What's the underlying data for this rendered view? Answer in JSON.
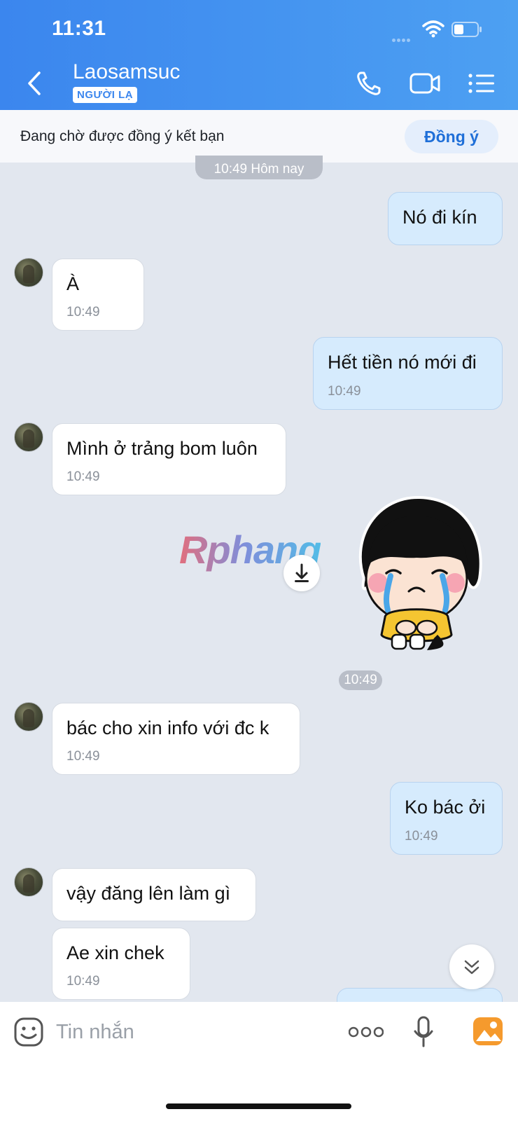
{
  "status_bar": {
    "time": "11:31"
  },
  "header": {
    "contact_name": "Laosamsuc",
    "stranger_badge": "NGƯỜI LẠ",
    "icons": [
      "back-icon",
      "phone-icon",
      "video-call-icon",
      "menu-list-icon"
    ]
  },
  "friend_request": {
    "text": "Đang chờ được đồng ý kết bạn",
    "accept_label": "Đồng ý"
  },
  "chat": {
    "date_separator": "10:49 Hôm nay",
    "messages": [
      {
        "from": "me",
        "text": "Nó đi kín",
        "time": ""
      },
      {
        "from": "them",
        "text": "À",
        "time": "10:49"
      },
      {
        "from": "me",
        "text": "Hết tiền nó mới đi",
        "time": "10:49"
      },
      {
        "from": "them",
        "text": "Mình ở trảng bom luôn",
        "time": "10:49"
      },
      {
        "from": "me",
        "type": "sticker",
        "sticker": "crying-girl-sticker",
        "time": "10:49"
      },
      {
        "from": "them",
        "text": "bác cho xin info với đc k",
        "time": "10:49"
      },
      {
        "from": "me",
        "text": "Ko bác ởi",
        "time": "10:49"
      },
      {
        "from": "them",
        "text": "vậy đăng lên làm gì",
        "time": ""
      },
      {
        "from": "them",
        "text": "Ae xin chek",
        "time": "10:49"
      }
    ],
    "watermark": "Rphang"
  },
  "composer": {
    "placeholder": "Tin nhắn",
    "icons": [
      "emoji-icon",
      "more-icon",
      "microphone-icon",
      "image-icon"
    ]
  },
  "colors": {
    "header": "#3b86ee",
    "accent": "#1f6fd8",
    "outgoing_bubble": "#d6ebfd",
    "background": "#e2e7ef"
  }
}
